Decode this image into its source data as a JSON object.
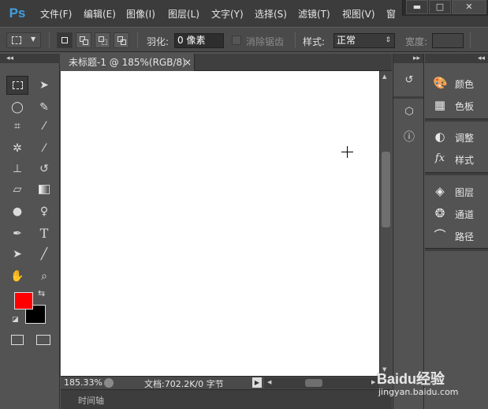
{
  "app": {
    "logo": "Ps"
  },
  "menu": [
    "文件(F)",
    "编辑(E)",
    "图像(I)",
    "图层(L)",
    "文字(Y)",
    "选择(S)",
    "滤镜(T)",
    "视图(V)",
    "窗"
  ],
  "window_controls": {
    "minimize": "▬",
    "restore": "□",
    "close": "✕"
  },
  "options": {
    "feather_label": "羽化:",
    "feather_value": "0 像素",
    "antialias_label": "消除锯齿",
    "style_label": "样式:",
    "style_value": "正常",
    "width_label": "宽度:"
  },
  "document": {
    "tab_title": "未标题-1 @ 185%(RGB/8)",
    "tab_close": "×"
  },
  "status": {
    "zoom": "185.33%",
    "doc_info": "文档:702.2K/0 字节"
  },
  "timeline": {
    "label": "时间轴"
  },
  "panels": {
    "color": "颜色",
    "swatches": "色板",
    "adjustments": "调整",
    "styles": "样式",
    "layers": "图层",
    "channels": "通道",
    "paths": "路径"
  },
  "colors": {
    "foreground": "#ff0000",
    "background": "#000000"
  },
  "watermark": {
    "brand": "Baidu经验",
    "url": "jingyan.baidu.com"
  }
}
